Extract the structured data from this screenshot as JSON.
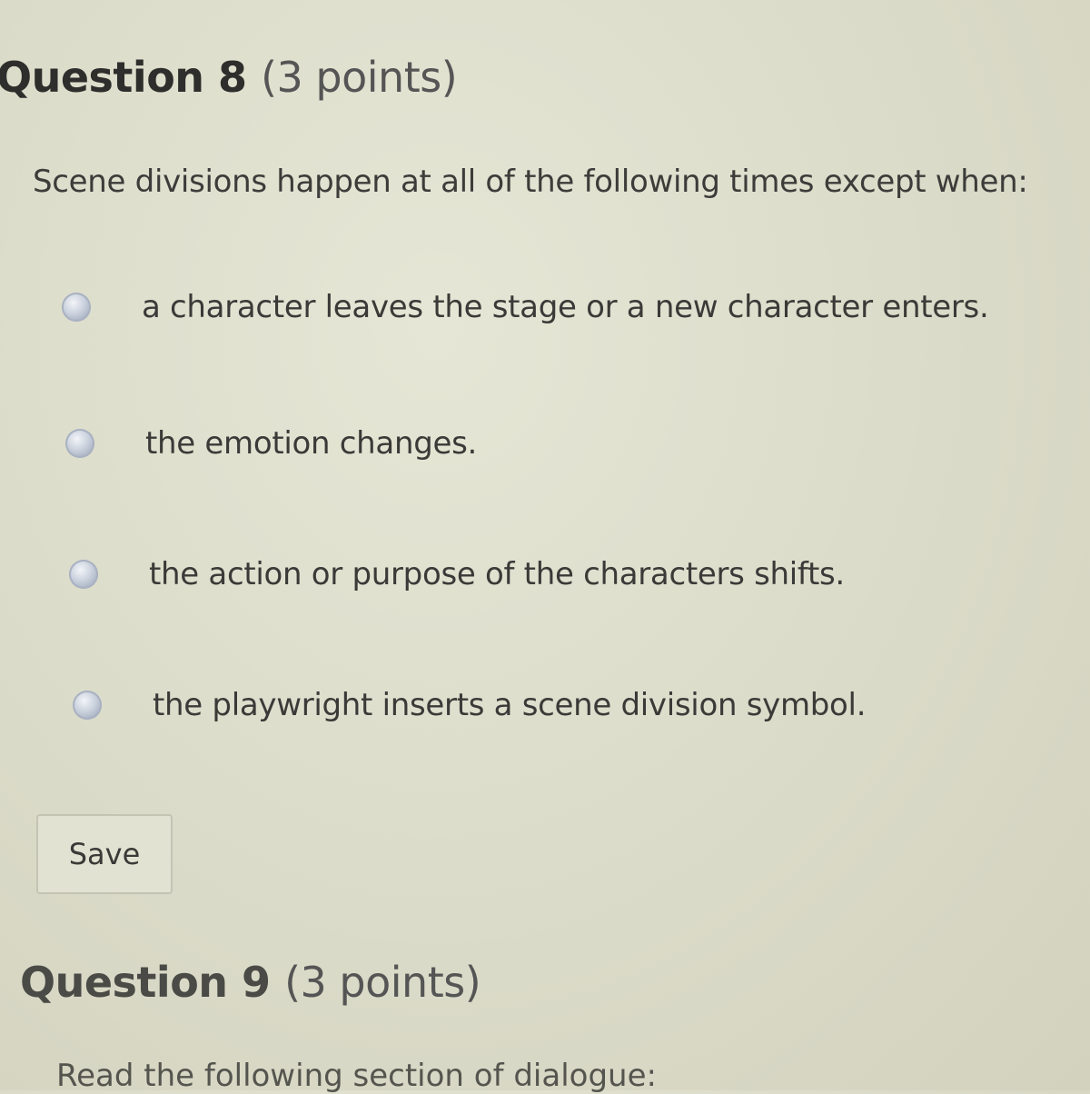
{
  "question8": {
    "title": "Question 8",
    "points": "(3 points)",
    "prompt": "Scene divisions happen at all of the following times except when:",
    "options": [
      {
        "label": "a character leaves the stage or a new character enters."
      },
      {
        "label": "the emotion changes."
      },
      {
        "label": "the action or purpose of the characters shifts."
      },
      {
        "label": "the playwright inserts a scene division symbol."
      }
    ],
    "save_label": "Save"
  },
  "question9": {
    "title": "Question 9",
    "points": "(3 points)",
    "prompt": "Read the following section of dialogue:"
  }
}
